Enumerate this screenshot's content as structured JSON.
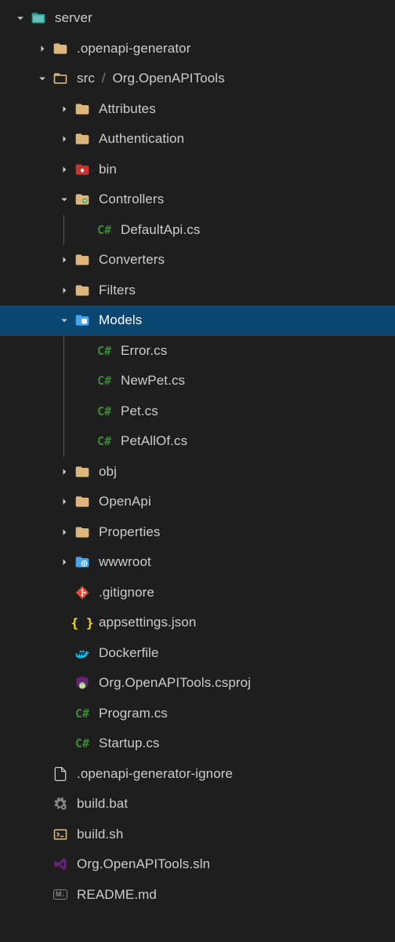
{
  "colors": {
    "bg": "#1e1e1e",
    "fg": "#cccccc",
    "selectedBg": "#094771",
    "folder": "#dcb67a",
    "folderTeal": "#26a69a",
    "csGreen": "#388a34",
    "git": "#dd4c35",
    "json": "#f5de19",
    "docker": "#0db7ed",
    "csproj": "#68217a",
    "vs": "#68217a",
    "terminal": "#e5c07b",
    "file": "#cccccc",
    "ruby": "#cc342d",
    "blue": "#42a5f5"
  },
  "tree": [
    {
      "depth": 0,
      "expand": "expanded",
      "iconType": "folder-root",
      "label": "server",
      "selected": false
    },
    {
      "depth": 1,
      "expand": "collapsed",
      "iconType": "folder",
      "label": ".openapi-generator",
      "selected": false
    },
    {
      "depth": 1,
      "expand": "expanded",
      "iconType": "folder-open",
      "label": "src / Org.OpenAPITools",
      "selected": false,
      "hasBreadcrumb": true,
      "part1": "src",
      "part2": "Org.OpenAPITools"
    },
    {
      "depth": 2,
      "expand": "collapsed",
      "iconType": "folder",
      "label": "Attributes",
      "selected": false
    },
    {
      "depth": 2,
      "expand": "collapsed",
      "iconType": "folder",
      "label": "Authentication",
      "selected": false
    },
    {
      "depth": 2,
      "expand": "collapsed",
      "iconType": "folder-ruby",
      "label": "bin",
      "selected": false
    },
    {
      "depth": 2,
      "expand": "expanded",
      "iconType": "folder-controller",
      "label": "Controllers",
      "selected": false
    },
    {
      "depth": 3,
      "expand": "none",
      "iconType": "cs",
      "label": "DefaultApi.cs",
      "selected": false,
      "guide": true
    },
    {
      "depth": 2,
      "expand": "collapsed",
      "iconType": "folder",
      "label": "Converters",
      "selected": false
    },
    {
      "depth": 2,
      "expand": "collapsed",
      "iconType": "folder",
      "label": "Filters",
      "selected": false
    },
    {
      "depth": 2,
      "expand": "expanded",
      "iconType": "folder-db",
      "label": "Models",
      "selected": true
    },
    {
      "depth": 3,
      "expand": "none",
      "iconType": "cs",
      "label": "Error.cs",
      "selected": false,
      "guide": true
    },
    {
      "depth": 3,
      "expand": "none",
      "iconType": "cs",
      "label": "NewPet.cs",
      "selected": false,
      "guide": true
    },
    {
      "depth": 3,
      "expand": "none",
      "iconType": "cs",
      "label": "Pet.cs",
      "selected": false,
      "guide": true
    },
    {
      "depth": 3,
      "expand": "none",
      "iconType": "cs",
      "label": "PetAllOf.cs",
      "selected": false,
      "guide": true
    },
    {
      "depth": 2,
      "expand": "collapsed",
      "iconType": "folder",
      "label": "obj",
      "selected": false
    },
    {
      "depth": 2,
      "expand": "collapsed",
      "iconType": "folder",
      "label": "OpenApi",
      "selected": false
    },
    {
      "depth": 2,
      "expand": "collapsed",
      "iconType": "folder",
      "label": "Properties",
      "selected": false
    },
    {
      "depth": 2,
      "expand": "collapsed",
      "iconType": "folder-www",
      "label": "wwwroot",
      "selected": false
    },
    {
      "depth": 2,
      "expand": "none",
      "iconType": "git",
      "label": ".gitignore",
      "selected": false
    },
    {
      "depth": 2,
      "expand": "none",
      "iconType": "json",
      "label": "appsettings.json",
      "selected": false
    },
    {
      "depth": 2,
      "expand": "none",
      "iconType": "docker",
      "label": "Dockerfile",
      "selected": false
    },
    {
      "depth": 2,
      "expand": "none",
      "iconType": "csproj",
      "label": "Org.OpenAPITools.csproj",
      "selected": false
    },
    {
      "depth": 2,
      "expand": "none",
      "iconType": "cs",
      "label": "Program.cs",
      "selected": false
    },
    {
      "depth": 2,
      "expand": "none",
      "iconType": "cs",
      "label": "Startup.cs",
      "selected": false
    },
    {
      "depth": 1,
      "expand": "none",
      "iconType": "file",
      "label": ".openapi-generator-ignore",
      "selected": false
    },
    {
      "depth": 1,
      "expand": "none",
      "iconType": "gear",
      "label": "build.bat",
      "selected": false
    },
    {
      "depth": 1,
      "expand": "none",
      "iconType": "terminal",
      "label": "build.sh",
      "selected": false
    },
    {
      "depth": 1,
      "expand": "none",
      "iconType": "vs",
      "label": "Org.OpenAPITools.sln",
      "selected": false
    },
    {
      "depth": 1,
      "expand": "none",
      "iconType": "md",
      "label": "README.md",
      "selected": false
    }
  ]
}
